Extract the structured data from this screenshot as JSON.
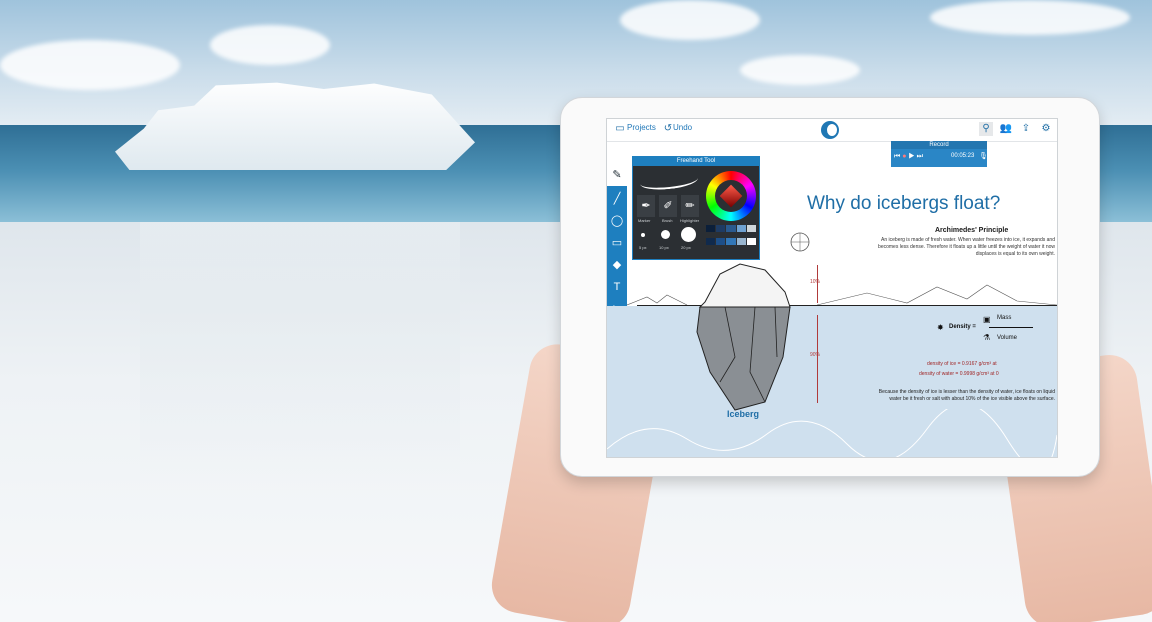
{
  "topbar": {
    "projects_label": "Projects",
    "undo_label": "Undo"
  },
  "record": {
    "title": "Record",
    "timer": "00:05:23"
  },
  "freehand_tool": {
    "title": "Freehand Tool",
    "brushes": [
      "Marker",
      "Brush",
      "Highlighter"
    ],
    "sizes": [
      "5 px",
      "10 px",
      "20 px"
    ]
  },
  "canvas": {
    "title": "Why do icebergs float?",
    "subtitle": "Archimedes' Principle",
    "paragraph": "An iceberg is made of fresh water. When water freezes into ice, it expands and becomes less dense. Therefore it floats up a little until the weight of water it now displaces is equal to its own weight.",
    "above_pct": "10%",
    "below_pct": "90%",
    "iceberg_label": "Iceberg",
    "density_label": "Density =",
    "mass_label": "Mass",
    "volume_label": "Volume",
    "density_ice": "density of ice = 0.9167 g/cm³ at",
    "density_water": "density of water = 0.9998 g/cm³ at 0",
    "footer": "Because the density of ice is lesser than the density of water, ice floats on liquid water be it fresh or salt with about 10% of the ice visible above the surface."
  },
  "colors": {
    "accent": "#1e7fbf",
    "water": "#cfe0ee",
    "measure": "#b03a3a"
  },
  "icons": {
    "toolbar": [
      "pen-icon",
      "line-icon",
      "bubble-icon",
      "image-icon",
      "eraser-icon",
      "text-icon",
      "scissors-icon",
      "gallery-icon",
      "film-icon"
    ],
    "topbar_right": [
      "pin-icon",
      "users-icon",
      "share-icon",
      "gear-icon"
    ]
  }
}
